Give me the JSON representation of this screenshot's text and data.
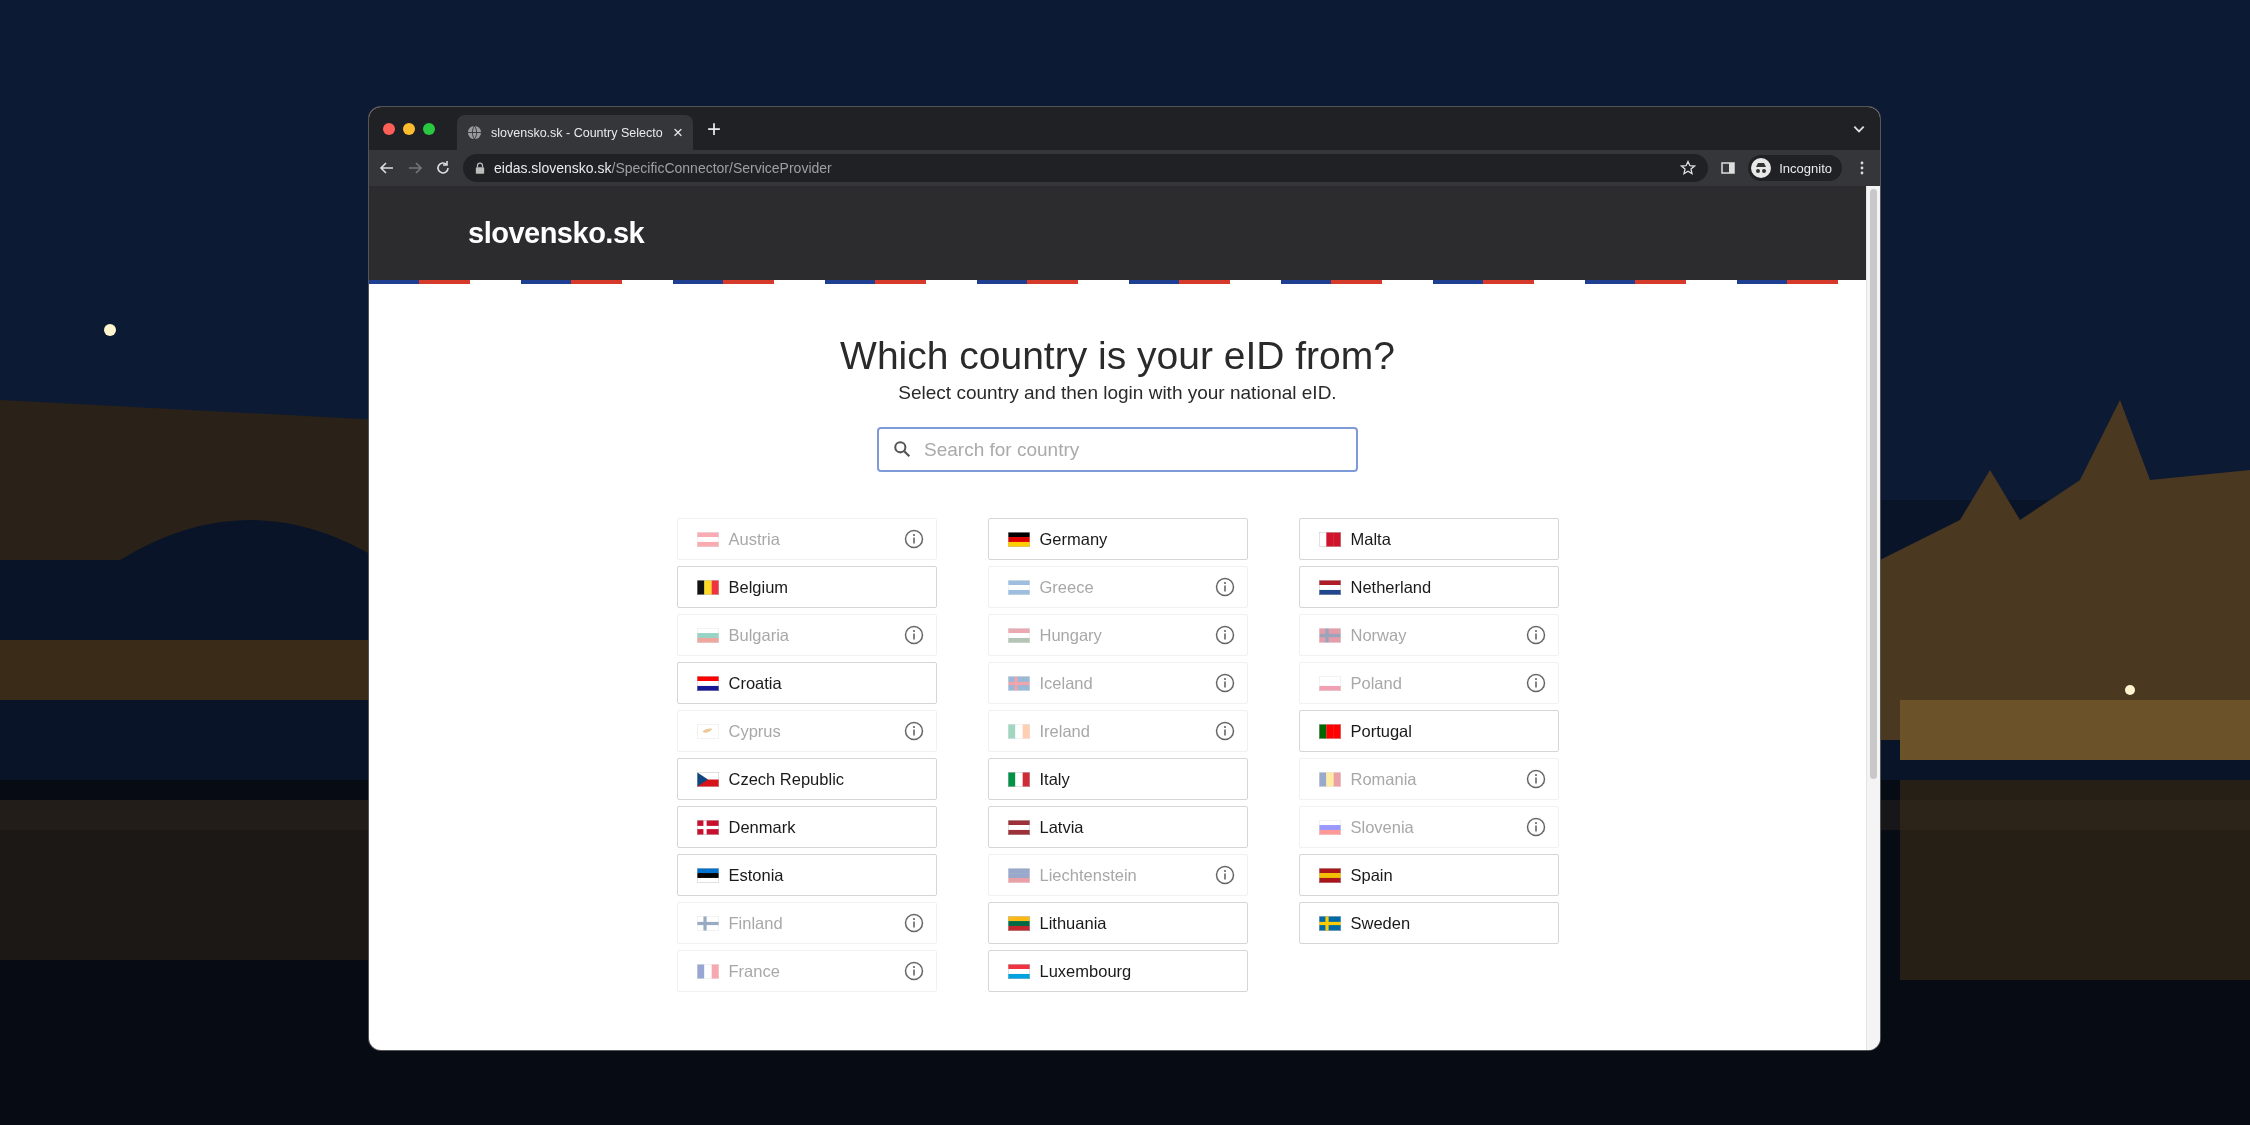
{
  "browser": {
    "tab": {
      "title": "slovensko.sk - Country Selecto",
      "close": "×"
    },
    "new_tab": "+",
    "url": {
      "host": "eidas.slovensko.sk",
      "path": "/SpecificConnector/ServiceProvider"
    },
    "profile": "Incognito"
  },
  "site": {
    "logo": "slovensko.sk"
  },
  "heading": "Which country is your eID from?",
  "subheading": "Select country and then login with your national eID.",
  "search": {
    "placeholder": "Search for country"
  },
  "columns": [
    [
      {
        "name": "Austria",
        "disabled": true
      },
      {
        "name": "Belgium",
        "disabled": false
      },
      {
        "name": "Bulgaria",
        "disabled": true
      },
      {
        "name": "Croatia",
        "disabled": false
      },
      {
        "name": "Cyprus",
        "disabled": true
      },
      {
        "name": "Czech Republic",
        "disabled": false
      },
      {
        "name": "Denmark",
        "disabled": false
      },
      {
        "name": "Estonia",
        "disabled": false
      },
      {
        "name": "Finland",
        "disabled": true
      },
      {
        "name": "France",
        "disabled": true
      }
    ],
    [
      {
        "name": "Germany",
        "disabled": false
      },
      {
        "name": "Greece",
        "disabled": true
      },
      {
        "name": "Hungary",
        "disabled": true
      },
      {
        "name": "Iceland",
        "disabled": true
      },
      {
        "name": "Ireland",
        "disabled": true
      },
      {
        "name": "Italy",
        "disabled": false
      },
      {
        "name": "Latvia",
        "disabled": false
      },
      {
        "name": "Liechtenstein",
        "disabled": true
      },
      {
        "name": "Lithuania",
        "disabled": false
      },
      {
        "name": "Luxembourg",
        "disabled": false
      }
    ],
    [
      {
        "name": "Malta",
        "disabled": false
      },
      {
        "name": "Netherland",
        "disabled": false
      },
      {
        "name": "Norway",
        "disabled": true
      },
      {
        "name": "Poland",
        "disabled": true
      },
      {
        "name": "Portugal",
        "disabled": false
      },
      {
        "name": "Romania",
        "disabled": true
      },
      {
        "name": "Slovenia",
        "disabled": true
      },
      {
        "name": "Spain",
        "disabled": false
      },
      {
        "name": "Sweden",
        "disabled": false
      }
    ]
  ]
}
